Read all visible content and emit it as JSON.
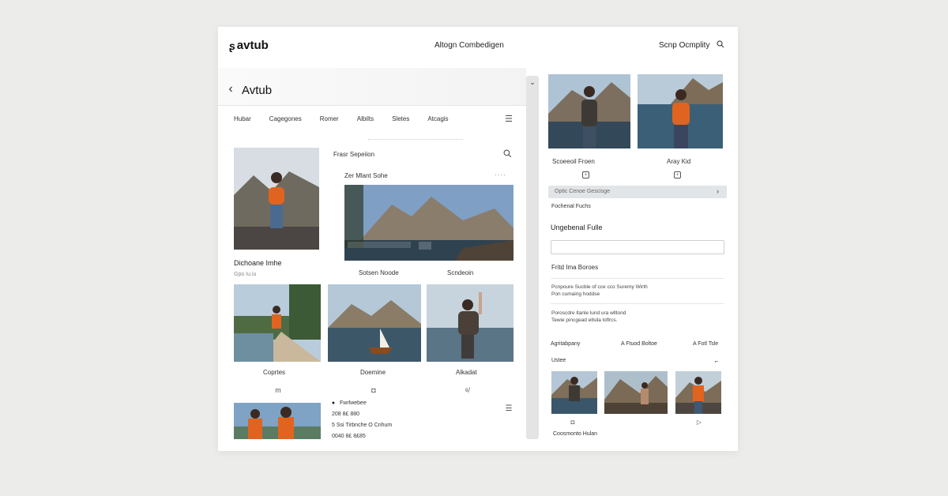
{
  "header": {
    "logo": "avtub",
    "center_title": "Altogn Combedigen",
    "right_link": "Scnp Ocmplity"
  },
  "left": {
    "page_title": "Avtub",
    "tabs": [
      "Hubar",
      "Cagegones",
      "Romer",
      "Albilts",
      "Sletes",
      "Atcagis"
    ],
    "feature_card": {
      "title": "Dichoane Imhe",
      "subtitle": "Gpo Iu.iu"
    },
    "search_label": "Frasr Sepeiion",
    "section_title": "Zer Mlant Sohe",
    "hero_captions": [
      "Sotsen Noode",
      "Scndeoin"
    ],
    "grid": [
      {
        "caption": "Coprtes",
        "icon": "m"
      },
      {
        "caption": "Doemine",
        "icon": "◘"
      },
      {
        "caption": "Alkadat",
        "icon": "ᵍ/"
      }
    ],
    "bottom_list": {
      "items": [
        "Fwrlwebee",
        "208 8£ 880",
        "5 Ssi Tirbnche O Cnhum",
        "0040 8£ 8£85"
      ]
    }
  },
  "right": {
    "top_captions": [
      "Scoeeoil Froen",
      "Aray Kid"
    ],
    "select_value": "Optic Cenoe Gescisge",
    "select_note": "Fochenal Fuchs",
    "section_title": "Ungebenal Fulle",
    "input_value": "",
    "list_title": "Fritd Ima Boroes",
    "text_block_1": [
      "Pcnpoure Sucble of cce cco Suremy Wirth",
      "Pon cumaing hoddse"
    ],
    "text_block_2": [
      "Poroscdre ltanle lund ura wlltond",
      "Tewie pincgead ellsila loflrcs."
    ],
    "filters": [
      "Agritabpany",
      "A Ftuod Boltoe",
      "A Fotl Tsle"
    ],
    "bottom_label": "Ustee",
    "bottom_caption": "Coosmonto Hulan"
  }
}
